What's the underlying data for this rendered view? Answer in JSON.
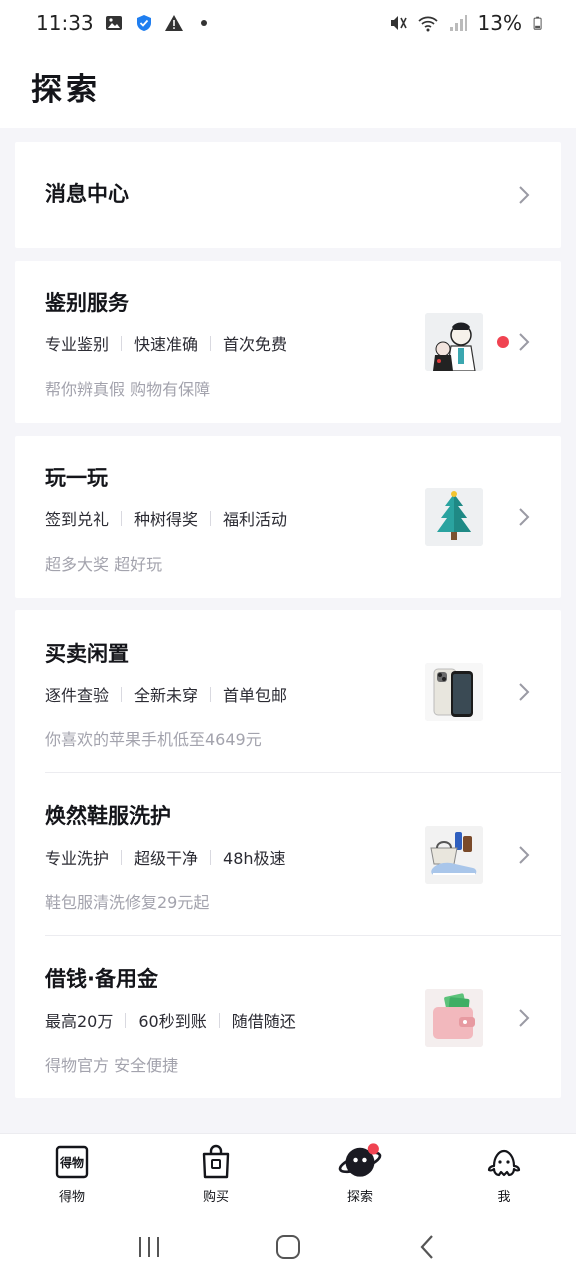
{
  "status_bar": {
    "time": "11:33",
    "battery": "13%"
  },
  "header": {
    "title": "探索"
  },
  "message_center": {
    "title": "消息中心"
  },
  "sections": {
    "identify": {
      "title": "鉴别服务",
      "tags": [
        "专业鉴别",
        "快速准确",
        "首次免费"
      ],
      "subtext": "帮你辨真假 购物有保障"
    },
    "play": {
      "title": "玩一玩",
      "tags": [
        "签到兑礼",
        "种树得奖",
        "福利活动"
      ],
      "subtext": "超多大奖 超好玩"
    },
    "resale": {
      "title": "买卖闲置",
      "tags": [
        "逐件查验",
        "全新未穿",
        "首单包邮"
      ],
      "subtext": "你喜欢的苹果手机低至4649元"
    },
    "wash": {
      "title": "焕然鞋服洗护",
      "tags": [
        "专业洗护",
        "超级干净",
        "48h极速"
      ],
      "subtext": "鞋包服清洗修复29元起"
    },
    "loan": {
      "title": "借钱·备用金",
      "tags": [
        "最高20万",
        "60秒到账",
        "随借随还"
      ],
      "subtext": "得物官方 安全便捷"
    }
  },
  "tabbar": {
    "tabs": [
      {
        "label": "得物",
        "icon": "dewu-logo-icon"
      },
      {
        "label": "购买",
        "icon": "shopping-bag-icon"
      },
      {
        "label": "探索",
        "icon": "planet-icon"
      },
      {
        "label": "我",
        "icon": "ghost-icon"
      }
    ]
  },
  "colors": {
    "accent_red": "#f04351",
    "background": "#f5f5f9",
    "subtext": "#a3a3ad"
  }
}
